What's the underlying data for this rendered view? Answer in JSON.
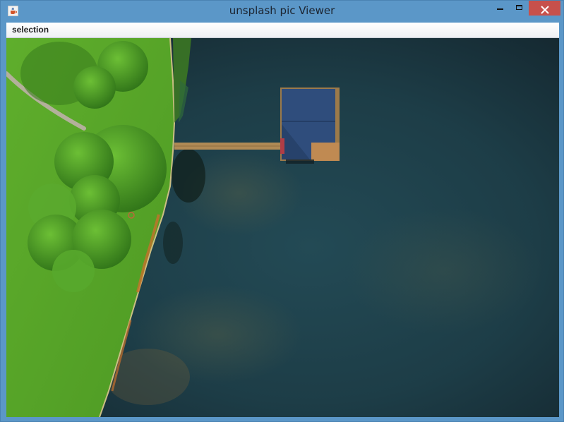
{
  "window": {
    "title": "unsplash pic Viewer",
    "app_icon": "java-cup-icon",
    "controls": {
      "minimize": "minimize-icon",
      "maximize": "maximize-icon",
      "close": "close-icon"
    },
    "close_color": "#c7504b"
  },
  "menubar": {
    "items": [
      {
        "label": "selection"
      }
    ]
  },
  "image": {
    "subject": "aerial photo of a lake with a dock and boathouse beside a grassy shore with trees",
    "colors": {
      "water": "#1e3c45",
      "grass": "#57a82a",
      "trees": "#3f8a22",
      "roof": "#2f4d7c",
      "dock": "#b08a55"
    }
  }
}
